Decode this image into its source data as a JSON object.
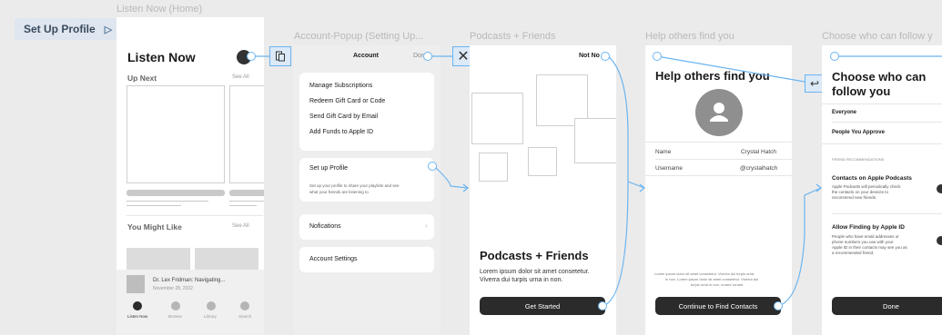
{
  "flow": {
    "title": "Set Up Profile"
  },
  "frames": {
    "f1": "Listen Now (Home)",
    "f2": "Account-Popup (Setting Up...",
    "f3": "Podcasts + Friends",
    "f4": "Help others find you",
    "f5": "Choose who can follow y"
  },
  "listen_now": {
    "title": "Listen Now",
    "up_next": "Up Next",
    "see_all_1": "See All",
    "might_like": "You Might Like",
    "see_all_2": "See All",
    "player_title": "Dr. Lex Fridman: Navigating...",
    "player_date": "November 28, 2022",
    "tabs": [
      "Listen Now",
      "Browse",
      "Library",
      "Search"
    ]
  },
  "account": {
    "title": "Account",
    "done": "Don",
    "menu": [
      "Manage Subscriptions",
      "Redeem Gift Card or Code",
      "Send Gift Card by Email",
      "Add Funds to Apple ID"
    ],
    "setup": "Set up Profile",
    "setup_desc_1": "Set up your profile to share your playlists and see",
    "setup_desc_2": "what your friends are listening to",
    "notifications": "Nofications",
    "settings": "Account Settings"
  },
  "podcasts_friends": {
    "not_now": "Not No",
    "title": "Podcasts + Friends",
    "body_1": "Lorem ipsum dolor sit amet consetetur.",
    "body_2": "Viverra dui turpis urna in non.",
    "cta": "Get Started"
  },
  "help_find": {
    "title": "Help others find you",
    "name_label": "Name",
    "name_value": "Crystal Hatch",
    "username_label": "Username",
    "username_value": "@crystalhatch",
    "foot_1": "Lorem ipsum dolor sit amet consetetur. Viverra dui turpis urna",
    "foot_2": "in non. Lorem ipsum dolor sit amet consetetur. Viverra dui",
    "foot_3": "turpis urna in non. ornare ornare.",
    "cta": "Continue to Find Contacts"
  },
  "choose_follow": {
    "title_1": "Choose who can",
    "title_2": "follow you",
    "opt_everyone": "Everyone",
    "opt_approve": "People You Approve",
    "section": "FRIEND RECOMMENDATIONS",
    "contacts_title": "Contacts on Apple Podcasts",
    "contacts_1": "Apple Podcasts will periodically check",
    "contacts_2": "the contacts on your devices to",
    "contacts_3": "recommend new friends.",
    "apple_id_title": "Allow Finding by Apple ID",
    "apple_id_1": "People who have email addresses or",
    "apple_id_2": "phone numbers you use with your",
    "apple_id_3": "Apple ID in their contacts may see you as",
    "apple_id_4": "a recommended friend.",
    "done": "Done"
  },
  "icons": [
    "play-triangle-icon",
    "device-icon",
    "close-icon",
    "back-arrow-icon",
    "avatar-icon",
    "profile-placeholder-icon",
    "chevron-right-icon"
  ]
}
